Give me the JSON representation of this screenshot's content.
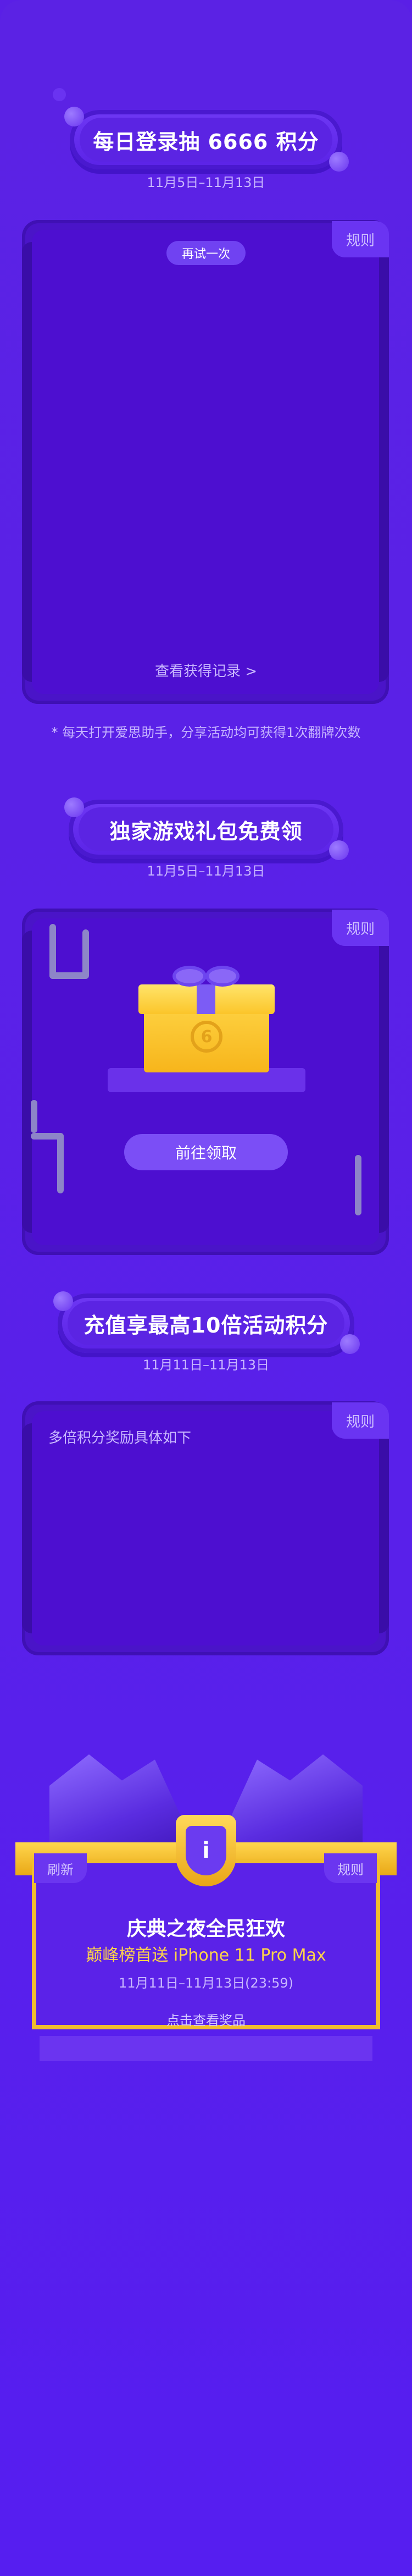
{
  "sections": [
    {
      "title": "每日登录抽 6666 积分",
      "date": "11月5日–11月13日",
      "rules_label": "规则",
      "retry_label": "再试一次",
      "records_link": "查看获得记录 >",
      "note": "* 每天打开爱思助手，分享活动均可获得1次翻牌次数"
    },
    {
      "title": "独家游戏礼包免费领",
      "date": "11月5日–11月13日",
      "rules_label": "规则",
      "claim_button": "前往领取"
    },
    {
      "title": "充值享最高10倍活动积分",
      "date": "11月11日–11月13日",
      "rules_label": "规则",
      "body_text": "多倍积分奖励具体如下"
    },
    {
      "refresh_label": "刷新",
      "rules_label": "规则",
      "title": "庆典之夜全民狂欢",
      "subtitle": "巅峰榜首送 iPhone 11 Pro Max",
      "date": "11月11日–11月13日(23:59)",
      "prizes_link": "点击查看奖品"
    }
  ],
  "colors": {
    "background": "#5a1fe6",
    "panel": "#4d0fd0",
    "gold": "#f7b51b",
    "accent": "#7b4ef6"
  }
}
